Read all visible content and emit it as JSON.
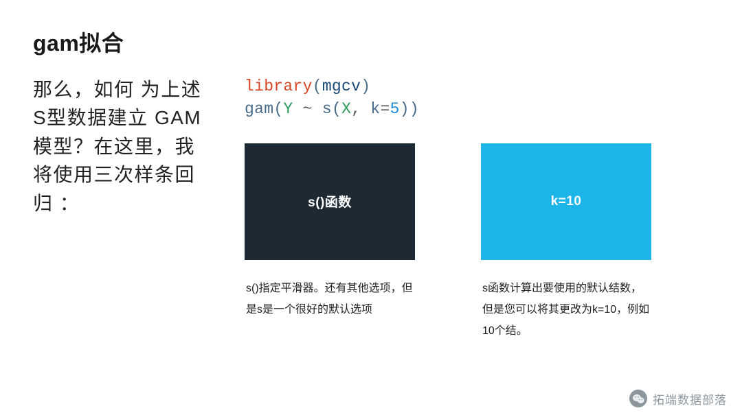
{
  "title": "gam拟合",
  "intro": "那么，如何 为上述S型数据建立 GAM模型？在这里，我将使用三次样条回归 ：",
  "code": {
    "library": "library",
    "mgcv": "mgcv",
    "gam": "gam",
    "Y": "Y",
    "tilde": "~",
    "s": "s",
    "X": "X",
    "k": "k",
    "eq": "=",
    "five": "5",
    "lp": "(",
    "rp": ")"
  },
  "cards": [
    {
      "header": "s()函数",
      "header_style": "dark",
      "desc": "s()指定平滑器。还有其他选项，但是s是一个很好的默认选项"
    },
    {
      "header": "k=10",
      "header_style": "cyan",
      "desc": "s函数计算出要使用的默认结数，但是您可以将其更改为k=10，例如10个结。"
    }
  ],
  "watermark": {
    "icon_name": "wechat-icon",
    "text": "拓端数据部落"
  }
}
